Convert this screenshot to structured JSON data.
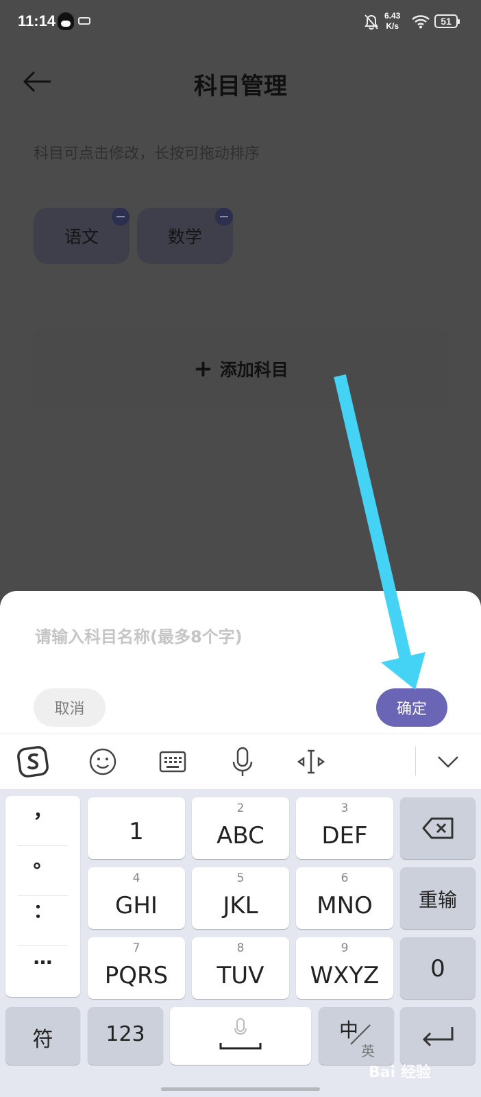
{
  "status_bar": {
    "time": "11:14",
    "net_speed_value": "6.43",
    "net_speed_unit": "K/s",
    "battery": "51"
  },
  "header": {
    "title": "科目管理"
  },
  "hint": "科目可点击修改，长按可拖动排序",
  "subjects": [
    {
      "label": "语文"
    },
    {
      "label": "数学"
    }
  ],
  "add_subject": {
    "icon": "+",
    "label": "添加科目"
  },
  "dialog": {
    "placeholder": "请输入科目名称(最多8个字)",
    "cancel_label": "取消",
    "confirm_label": "确定"
  },
  "keyboard_toolbar": {
    "icons": [
      "sogou-logo-icon",
      "emoji-icon",
      "keyboard-icon",
      "microphone-icon",
      "cursor-move-icon",
      "collapse-chevron-icon"
    ]
  },
  "keyboard": {
    "punctuation": [
      "，",
      "。",
      "：",
      "…"
    ],
    "keys": [
      {
        "num": "",
        "label": "1"
      },
      {
        "num": "2",
        "label": "ABC"
      },
      {
        "num": "3",
        "label": "DEF"
      },
      {
        "num": "4",
        "label": "GHI"
      },
      {
        "num": "5",
        "label": "JKL"
      },
      {
        "num": "6",
        "label": "MNO"
      },
      {
        "num": "7",
        "label": "PQRS"
      },
      {
        "num": "8",
        "label": "TUV"
      },
      {
        "num": "9",
        "label": "WXYZ"
      }
    ],
    "reinput": "重输",
    "zero": "0",
    "symbols": "符",
    "numbers": "123",
    "lang_top": "中",
    "lang_bottom": "英"
  },
  "watermark": "Bai 经验",
  "colors": {
    "overlay": "#4b4b4b",
    "accent": "#6a66b5",
    "arrow": "#45d3f5"
  }
}
